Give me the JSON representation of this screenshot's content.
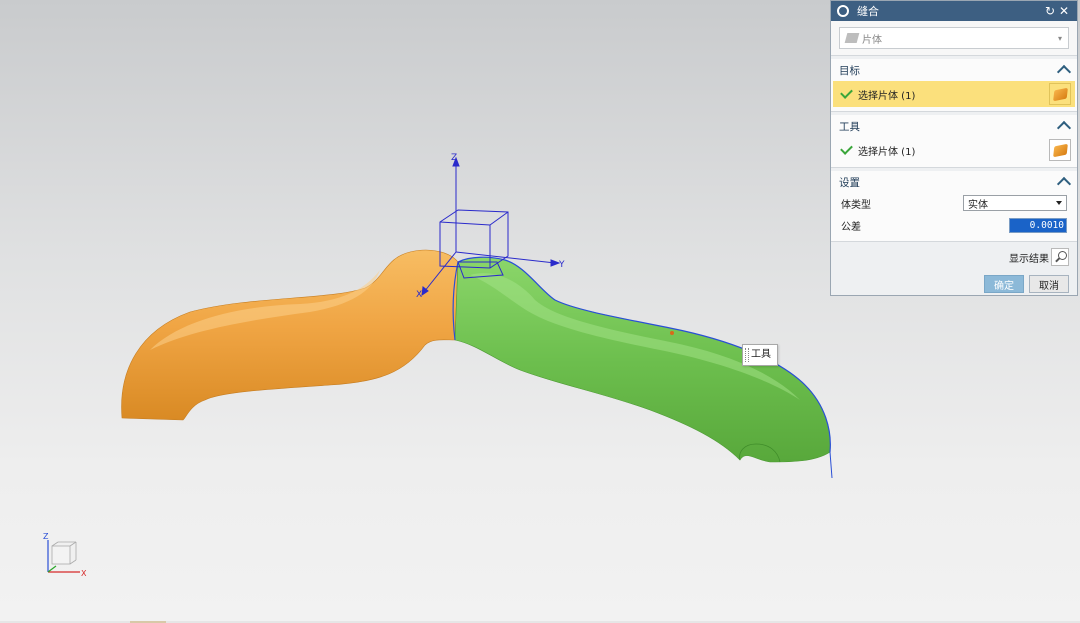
{
  "dialog": {
    "title": "缝合",
    "type": {
      "value": "片体",
      "icon": "sheet-body-icon"
    },
    "target": {
      "heading": "目标",
      "select_label": "选择片体 (1)",
      "icon": "sheet-body-icon"
    },
    "tool": {
      "heading": "工具",
      "select_label": "选择片体 (1)",
      "icon": "sheet-body-icon"
    },
    "settings": {
      "heading": "设置",
      "body_type_label": "体类型",
      "body_type_value": "实体",
      "tolerance_label": "公差",
      "tolerance_value": "0.0010"
    },
    "preview_label": "显示结果",
    "ok_label": "确定",
    "cancel_label": "取消"
  },
  "viewport": {
    "tool_tag": "工具",
    "csys_labels": {
      "z": "Z",
      "y": "Y",
      "x": "X"
    },
    "triad_labels": {
      "z": "Z",
      "x": "X"
    },
    "colors": {
      "target_body": "#f0a544",
      "tool_body": "#6dbf4e",
      "selection_edge": "#2a4fd6",
      "active_row": "#fbe07c",
      "titlebar": "#3d5f82"
    }
  }
}
